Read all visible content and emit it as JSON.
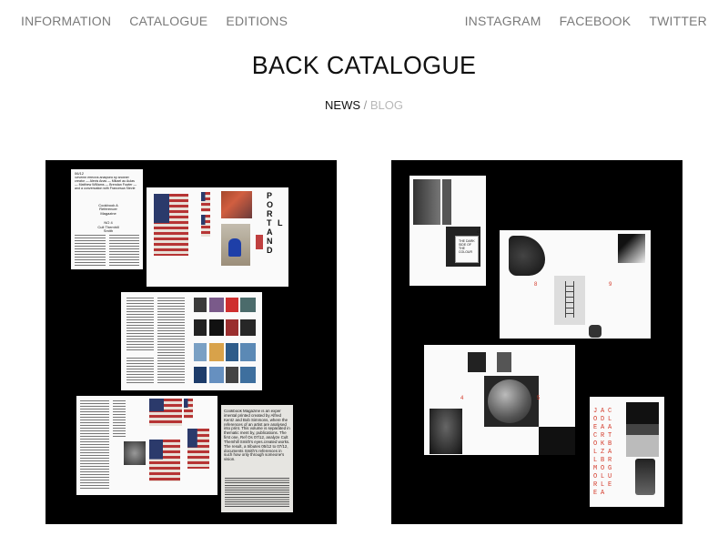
{
  "nav": {
    "left": [
      "INFORMATION",
      "CATALOGUE",
      "EDITIONS"
    ],
    "right": [
      "INSTAGRAM",
      "FACEBOOK",
      "TWITTER"
    ]
  },
  "page": {
    "title": "BACK CATALOGUE"
  },
  "subnav": {
    "active": "NEWS",
    "separator": " / ",
    "inactive": "BLOG"
  },
  "left_tile": {
    "sheet1": {
      "code": "06/12",
      "intro": "Seventh effect/is analysed by another creator — Alexis Anas — Mikael au Aulas — Matthew Williams — Brendan Fowler — and a conversation with Francesca Stevie",
      "pub": "Cookbook A Referencer Magazine",
      "issue": "NO 4",
      "subject": "Cult Themhill Smith"
    },
    "poster": "P O R T L A N D",
    "blurb": "Cookbook Magazine is an exper imental printed created by Alfred Kentz and Bob Simmons, where the references of an artist are analysed into print. This volume is separated in thematic ment by, publications. The first one, Ref Os 07/12, analyze Cult Themhill Smith's eyes.created works. The result, a tributes 05/12 to 07/12, documents Smith's references in such how only through someone's vision."
  },
  "right_tile": {
    "page_numbers": [
      "8",
      "9",
      "4",
      "5"
    ],
    "letter": "C",
    "small_card": "THE DARK SIDE OF THE COLOUR",
    "vertical_text": [
      "JOE COLLMORE",
      "A DARK ZBOLLA",
      "CLAT BAR GUE"
    ]
  },
  "colors": {
    "background": "#ffffff",
    "tile": "#000000",
    "accent_red": "#d43a2a",
    "nav": "#7a7a7a"
  }
}
